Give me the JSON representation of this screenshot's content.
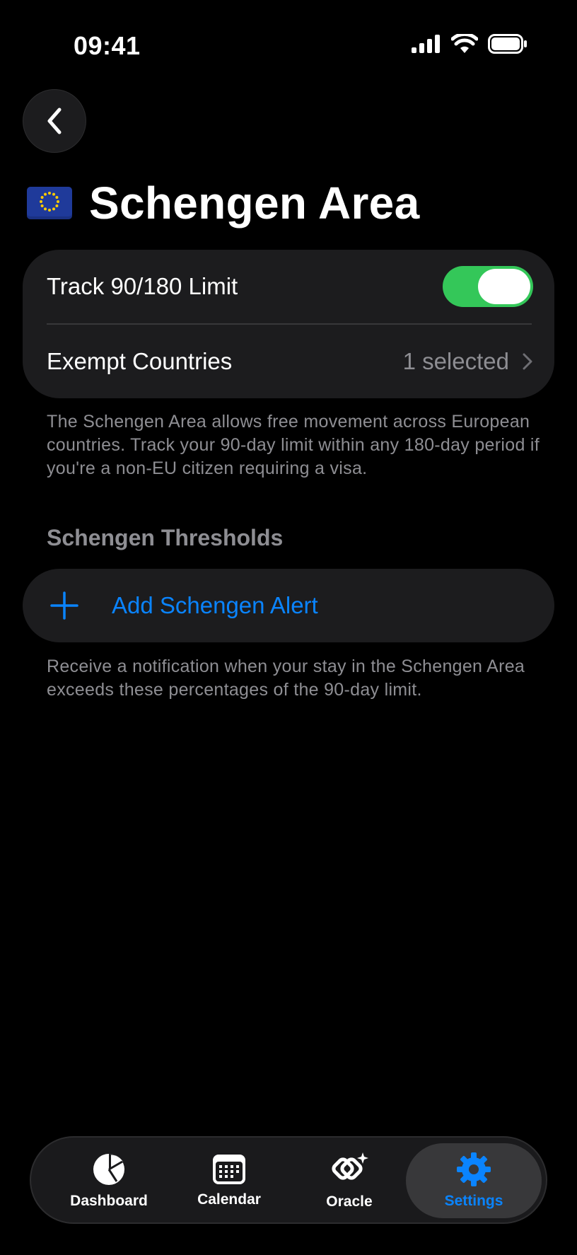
{
  "status_bar": {
    "time": "09:41"
  },
  "header": {
    "title": "Schengen Area",
    "flag_icon": "eu-flag-icon"
  },
  "settings_card": {
    "track_label": "Track 90/180 Limit",
    "track_enabled": true,
    "exempt_label": "Exempt Countries",
    "exempt_value": "1 selected"
  },
  "description": "The Schengen Area allows free movement across European countries. Track your 90-day limit within any 180-day period if you're a non-EU citizen requiring a visa.",
  "thresholds": {
    "header": "Schengen Thresholds",
    "add_label": "Add Schengen Alert",
    "footnote": "Receive a notification when your stay in the Schengen Area exceeds these percentages of the 90-day limit."
  },
  "tab_bar": {
    "tabs": [
      {
        "label": "Dashboard",
        "icon": "pie-chart-icon"
      },
      {
        "label": "Calendar",
        "icon": "calendar-icon"
      },
      {
        "label": "Oracle",
        "icon": "oracle-icon"
      },
      {
        "label": "Settings",
        "icon": "gear-icon"
      }
    ],
    "active": "Settings"
  },
  "colors": {
    "accent": "#0a84ff",
    "toggle_on": "#34c759",
    "card": "#1c1c1e",
    "secondary_text": "#8e8e93"
  }
}
